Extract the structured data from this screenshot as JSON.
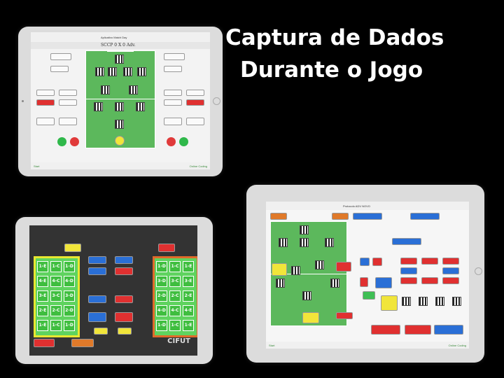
{
  "headline": {
    "line1": "Captura de Dados",
    "line2": "Durante o Jogo"
  },
  "tablet_top": {
    "nav_title": "Aplicativo Match Day",
    "score": "SCCP 0 X 0 Adv.",
    "bottom_left": "Start",
    "bottom_right": "Online Coding"
  },
  "tablet_bottom_left": {
    "footer_label": "CIFUT",
    "grid_left": [
      "1-E",
      "1-C",
      "1-D",
      "4-E",
      "4-C",
      "4-D",
      "3-E",
      "3-C",
      "3-D",
      "2-E",
      "2-C",
      "2-D",
      "1-E",
      "1-C",
      "1-D"
    ],
    "grid_right": [
      "1-D",
      "1-C",
      "1-E",
      "3-D",
      "3-C",
      "3-E",
      "2-D",
      "2-C",
      "2-E",
      "4-D",
      "4-C",
      "4-E",
      "1-D",
      "1-C",
      "1-E"
    ]
  },
  "tablet_bottom_right": {
    "nav_title": "Protocolo ADV NOVO",
    "bottom_left": "Start",
    "bottom_right": "Online Coding"
  }
}
